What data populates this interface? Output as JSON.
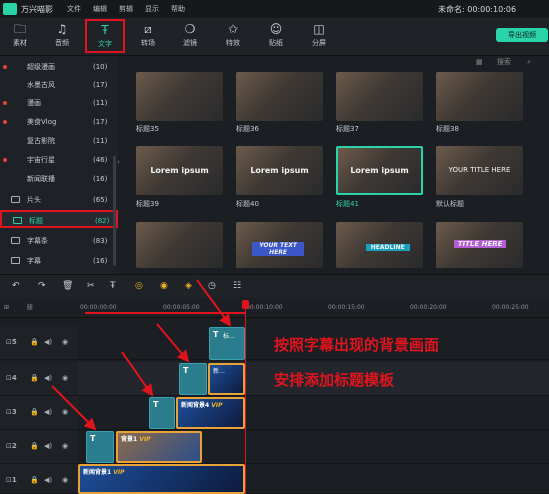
{
  "app": {
    "name": "万兴喵影",
    "project": "未命名: 00:00:10:06",
    "menu": [
      "文件",
      "编辑",
      "剪辑",
      "显示",
      "帮助"
    ]
  },
  "toolbar": {
    "tools": [
      {
        "label": "素材",
        "icon": "folder-icon"
      },
      {
        "label": "音频",
        "icon": "music-note-icon"
      },
      {
        "label": "文字",
        "icon": "text-icon"
      },
      {
        "label": "转场",
        "icon": "transition-icon"
      },
      {
        "label": "滤镜",
        "icon": "filter-icon"
      },
      {
        "label": "特效",
        "icon": "effects-icon"
      },
      {
        "label": "贴纸",
        "icon": "sticker-icon"
      },
      {
        "label": "分屏",
        "icon": "split-screen-icon"
      }
    ],
    "export_label": "导出视频"
  },
  "sidebar": {
    "items": [
      {
        "name": "超级漫画",
        "count": "(10)"
      },
      {
        "name": "水墨古风",
        "count": "(17)"
      },
      {
        "name": "漫画",
        "count": "(11)"
      },
      {
        "name": "美食Vlog",
        "count": "(17)"
      },
      {
        "name": "复古影院",
        "count": "(11)"
      },
      {
        "name": "宇宙行星",
        "count": "(46)"
      },
      {
        "name": "新闻联播",
        "count": "(16)"
      },
      {
        "name": "片头",
        "count": "(65)"
      },
      {
        "name": "标题",
        "count": "(82)"
      },
      {
        "name": "字幕条",
        "count": "(83)"
      },
      {
        "name": "字幕",
        "count": "(16)"
      }
    ]
  },
  "grid": {
    "search_label": "搜索",
    "cards": [
      {
        "label": "标题35",
        "caption": ""
      },
      {
        "label": "标题36",
        "caption": ""
      },
      {
        "label": "标题37",
        "caption": ""
      },
      {
        "label": "标题38",
        "caption": ""
      },
      {
        "label": "标题39",
        "caption": "Lorem ipsum"
      },
      {
        "label": "标题40",
        "caption": "Lorem ipsum"
      },
      {
        "label": "标题41",
        "caption": "Lorem ipsum"
      },
      {
        "label": "默认标题",
        "caption": "YOUR TITLE HERE"
      },
      {
        "label": "",
        "caption": ""
      },
      {
        "label": "",
        "caption": "YOUR TEXT HERE"
      },
      {
        "label": "",
        "caption": "HEADLINE"
      },
      {
        "label": "",
        "caption": "TITLE HERE"
      }
    ]
  },
  "timeline": {
    "ruler": [
      "00:00:00:00",
      "00:00:05:00",
      "00:00:10:00",
      "00:00:15:00",
      "00:00:20:00",
      "00:00:25:00"
    ],
    "tracks": [
      "5",
      "4",
      "3",
      "2",
      "1"
    ],
    "clips": {
      "text_label": "T",
      "text_top_label": "标…",
      "img4": "新…",
      "img3": "新闻背景4",
      "img2": "背景1",
      "img1": "新闻背景1",
      "vip": "VIP"
    }
  },
  "annotation": {
    "line1": "按照字幕出现的背景画面",
    "line2": "安排添加标题模板"
  },
  "colors": {
    "accent": "#2bd3a8",
    "highlight": "#e0141e"
  }
}
